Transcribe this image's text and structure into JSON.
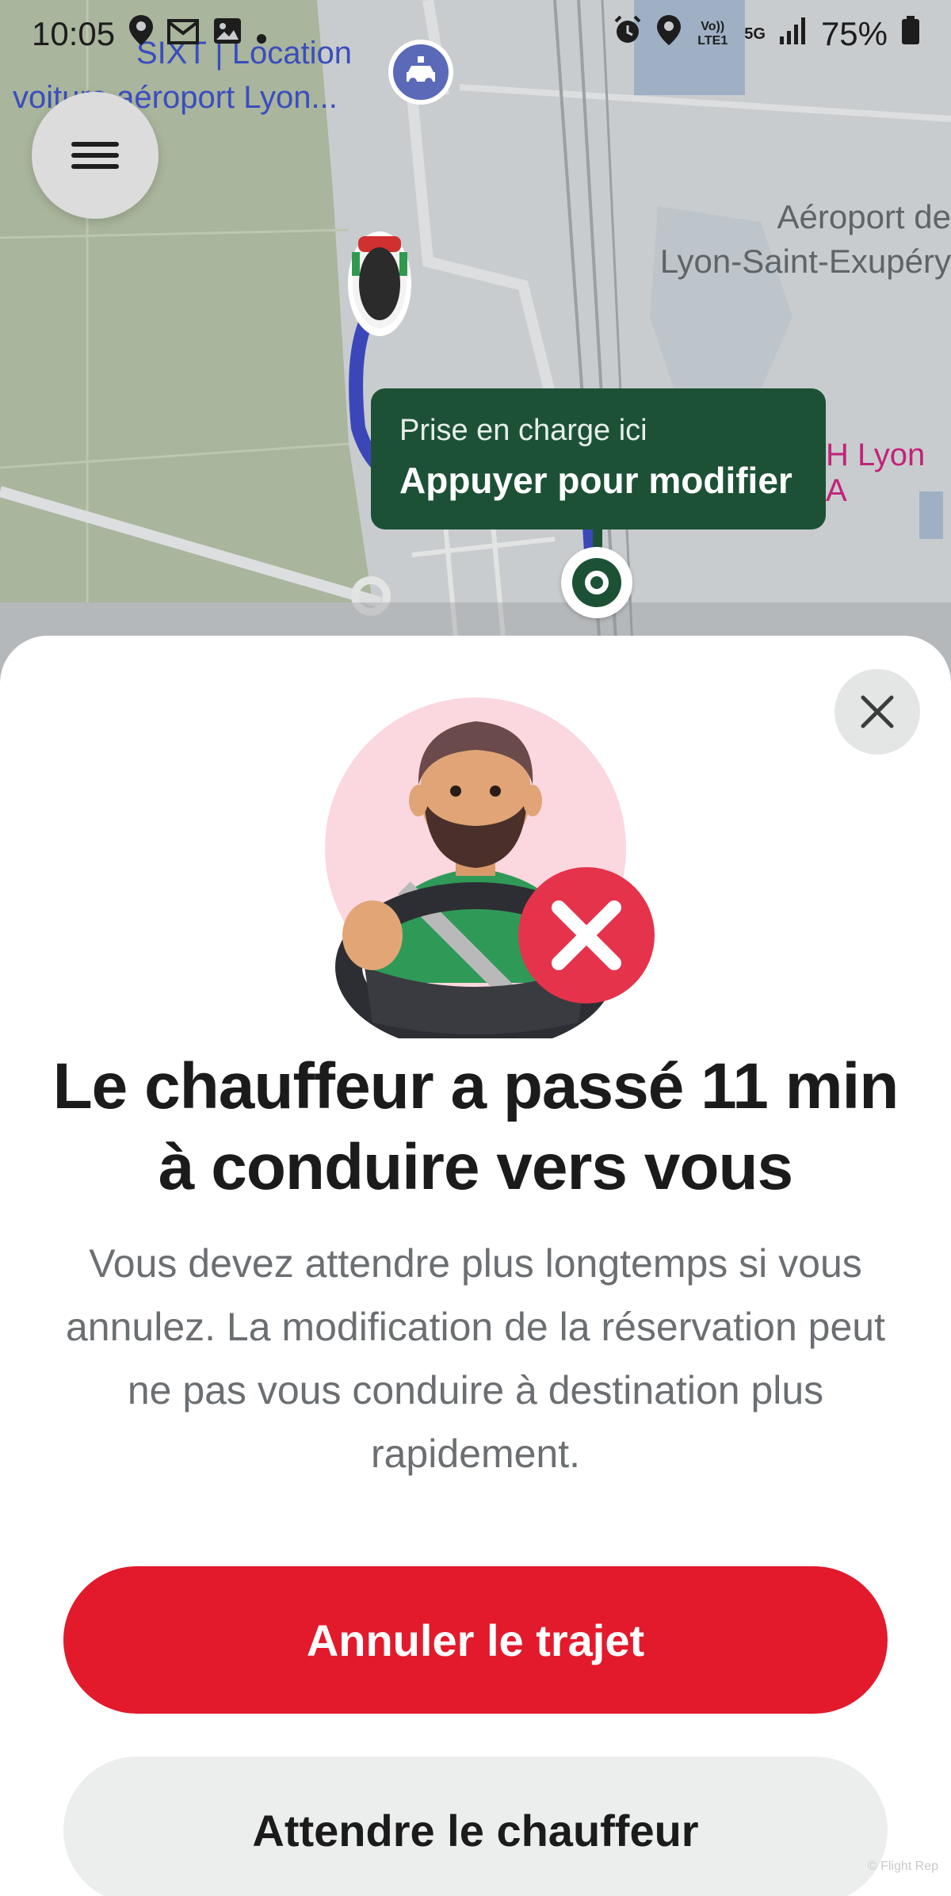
{
  "status_bar": {
    "time": "10:05",
    "left_icons": [
      "location-icon",
      "gmail-icon",
      "gallery-icon",
      "dot-icon"
    ],
    "right_icons": [
      "alarm-icon",
      "location-icon",
      "volte-icon",
      "5g-icon",
      "signal-icon"
    ],
    "volte_label": "Vo)) LTE1",
    "network_label": "5G",
    "battery": "75%"
  },
  "map": {
    "poi_line1": "SIXT | Location",
    "poi_line2": "voiture aéroport Lyon...",
    "airport_line1": "Aéroport de",
    "airport_line2": "Lyon-Saint-Exupéry",
    "pink_label": "H Lyon A",
    "pickup_tooltip": {
      "line1": "Prise en charge ici",
      "line2": "Appuyer pour modifier"
    },
    "colors": {
      "route": "#3b47b8",
      "pickup": "#1d5136",
      "land": "#c9ccce",
      "park": "#a9b59c",
      "water": "#9fb0c5"
    }
  },
  "sheet": {
    "close_icon": "close-icon",
    "headline": "Le chauffeur a passé 11 min à conduire vers vous",
    "body": "Vous devez attendre plus longtemps si vous annulez. La modification de la réservation peut ne pas vous conduire à destination plus rapidement.",
    "primary_button": "Annuler le trajet",
    "secondary_button": "Attendre le chauffeur",
    "watermark": "© Flight Rep",
    "colors": {
      "primary": "#e21a2c",
      "secondary_bg": "#eceeee"
    }
  }
}
